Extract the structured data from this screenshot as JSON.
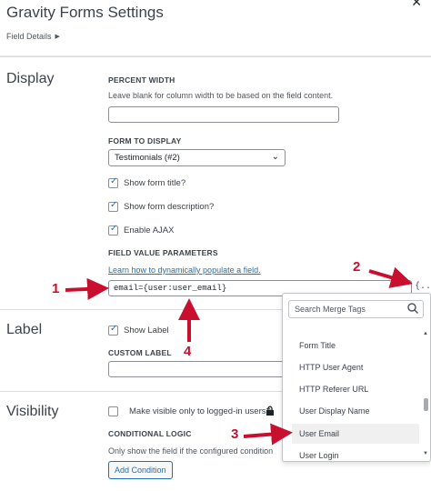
{
  "header": {
    "title": "Gravity Forms Settings",
    "breadcrumb": "Field Details",
    "close_icon": "close-icon"
  },
  "display": {
    "section_title": "Display",
    "percent_width_label": "PERCENT WIDTH",
    "percent_width_help": "Leave blank for column width to be based on the field content.",
    "percent_width_value": "",
    "form_to_display_label": "FORM TO DISPLAY",
    "form_to_display_value": "Testimonials (#2)",
    "show_title_label": "Show form title?",
    "show_description_label": "Show form description?",
    "enable_ajax_label": "Enable AJAX",
    "field_value_params_label": "FIELD VALUE PARAMETERS",
    "populate_link": "Learn how to dynamically populate a field.",
    "params_value": "email={user:user_email}",
    "merge_tag_button": "{..}"
  },
  "label_section": {
    "section_title": "Label",
    "show_label": "Show Label",
    "custom_label": "CUSTOM LABEL",
    "custom_label_value": ""
  },
  "visibility": {
    "section_title": "Visibility",
    "logged_in_label": "Make visible only to logged-in users?",
    "conditional_logic_label": "CONDITIONAL LOGIC",
    "conditional_logic_help": "Only show the field if the configured condition",
    "add_condition": "Add Condition"
  },
  "merge_tags": {
    "search_placeholder": "Search Merge Tags",
    "items": [
      "Form Title",
      "HTTP User Agent",
      "HTTP Referer URL",
      "User Display Name",
      "User Email",
      "User Login"
    ],
    "highlighted_index": 4
  },
  "annotations": [
    "1",
    "2",
    "3",
    "4"
  ],
  "colors": {
    "accent": "#2271b1",
    "annotation": "#c8102e"
  }
}
